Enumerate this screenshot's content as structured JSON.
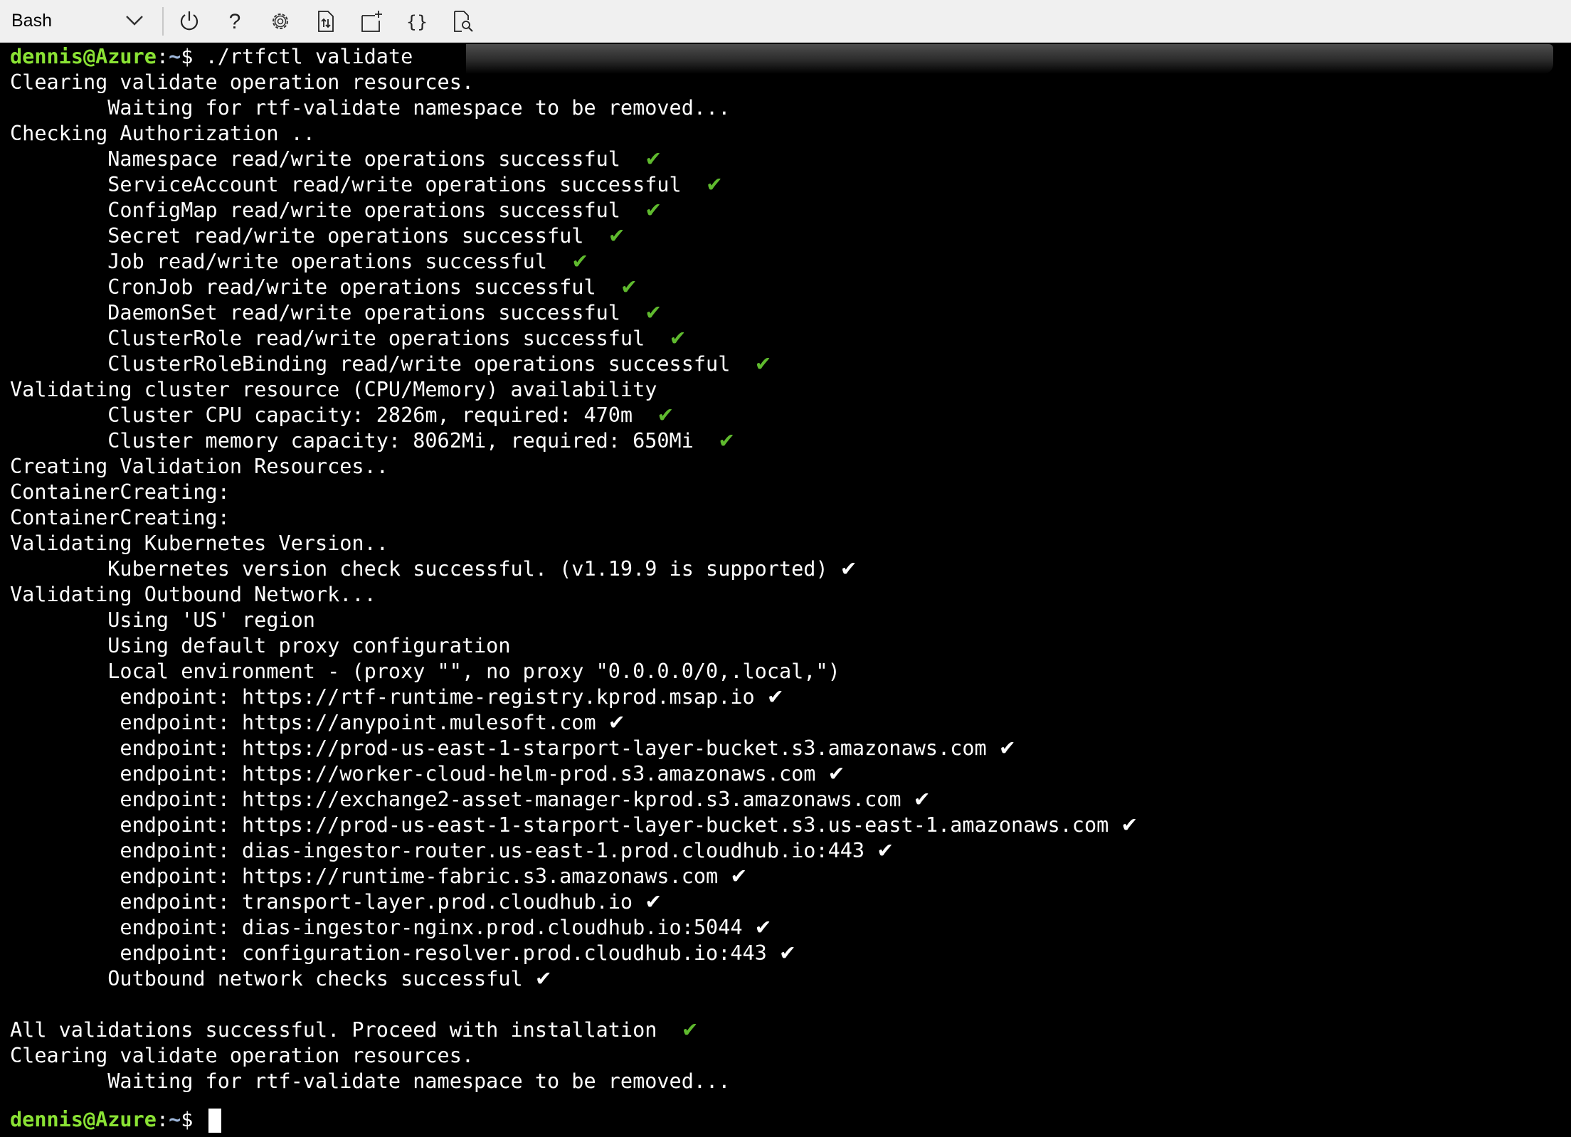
{
  "toolbar": {
    "shell": "Bash",
    "buttons": [
      {
        "name": "restart-button",
        "icon": "power-icon"
      },
      {
        "name": "help-button",
        "icon": "help-icon"
      },
      {
        "name": "settings-button",
        "icon": "gear-icon"
      },
      {
        "name": "upload-download-button",
        "icon": "file-transfer-icon"
      },
      {
        "name": "new-session-button",
        "icon": "new-session-icon"
      },
      {
        "name": "editor-button",
        "icon": "braces-icon"
      },
      {
        "name": "web-preview-button",
        "icon": "web-preview-icon"
      }
    ]
  },
  "colors": {
    "prompt_user": "#8ae234",
    "prompt_path": "#9fb8dc",
    "check_green": "#5fba2e",
    "terminal_bg": "#000000",
    "toolbar_bg": "#f0f0f0"
  },
  "prompt": {
    "user": "dennis@Azure",
    "colon": ":",
    "path": "~",
    "symbol": "$ "
  },
  "check_mark": "✔",
  "command": "./rtfctl validate",
  "lines": [
    {
      "text": "Clearing validate operation resources.",
      "check": ""
    },
    {
      "text": "        Waiting for rtf-validate namespace to be removed...",
      "check": ""
    },
    {
      "text": "Checking Authorization ..",
      "check": ""
    },
    {
      "text": "        Namespace read/write operations successful  ",
      "check": "green"
    },
    {
      "text": "        ServiceAccount read/write operations successful  ",
      "check": "green"
    },
    {
      "text": "        ConfigMap read/write operations successful  ",
      "check": "green"
    },
    {
      "text": "        Secret read/write operations successful  ",
      "check": "green"
    },
    {
      "text": "        Job read/write operations successful  ",
      "check": "green"
    },
    {
      "text": "        CronJob read/write operations successful  ",
      "check": "green"
    },
    {
      "text": "        DaemonSet read/write operations successful  ",
      "check": "green"
    },
    {
      "text": "        ClusterRole read/write operations successful  ",
      "check": "green"
    },
    {
      "text": "        ClusterRoleBinding read/write operations successful  ",
      "check": "green"
    },
    {
      "text": "Validating cluster resource (CPU/Memory) availability",
      "check": ""
    },
    {
      "text": "        Cluster CPU capacity: 2826m, required: 470m  ",
      "check": "green"
    },
    {
      "text": "        Cluster memory capacity: 8062Mi, required: 650Mi  ",
      "check": "green"
    },
    {
      "text": "Creating Validation Resources..",
      "check": ""
    },
    {
      "text": "ContainerCreating:",
      "check": ""
    },
    {
      "text": "ContainerCreating:",
      "check": ""
    },
    {
      "text": "Validating Kubernetes Version..",
      "check": ""
    },
    {
      "text": "        Kubernetes version check successful. (v1.19.9 is supported) ",
      "check": "white"
    },
    {
      "text": "Validating Outbound Network...",
      "check": ""
    },
    {
      "text": "        Using 'US' region",
      "check": ""
    },
    {
      "text": "        Using default proxy configuration",
      "check": ""
    },
    {
      "text": "        Local environment - (proxy \"\", no proxy \"0.0.0.0/0,.local,\")",
      "check": ""
    },
    {
      "text": "         endpoint: https://rtf-runtime-registry.kprod.msap.io ",
      "check": "white"
    },
    {
      "text": "         endpoint: https://anypoint.mulesoft.com ",
      "check": "white"
    },
    {
      "text": "         endpoint: https://prod-us-east-1-starport-layer-bucket.s3.amazonaws.com ",
      "check": "white"
    },
    {
      "text": "         endpoint: https://worker-cloud-helm-prod.s3.amazonaws.com ",
      "check": "white"
    },
    {
      "text": "         endpoint: https://exchange2-asset-manager-kprod.s3.amazonaws.com ",
      "check": "white"
    },
    {
      "text": "         endpoint: https://prod-us-east-1-starport-layer-bucket.s3.us-east-1.amazonaws.com ",
      "check": "white"
    },
    {
      "text": "         endpoint: dias-ingestor-router.us-east-1.prod.cloudhub.io:443 ",
      "check": "white"
    },
    {
      "text": "         endpoint: https://runtime-fabric.s3.amazonaws.com ",
      "check": "white"
    },
    {
      "text": "         endpoint: transport-layer.prod.cloudhub.io ",
      "check": "white"
    },
    {
      "text": "         endpoint: dias-ingestor-nginx.prod.cloudhub.io:5044 ",
      "check": "white"
    },
    {
      "text": "         endpoint: configuration-resolver.prod.cloudhub.io:443 ",
      "check": "white"
    },
    {
      "text": "        Outbound network checks successful ",
      "check": "white"
    },
    {
      "text": "",
      "check": ""
    },
    {
      "text": "All validations successful. Proceed with installation  ",
      "check": "green"
    },
    {
      "text": "Clearing validate operation resources.",
      "check": ""
    },
    {
      "text": "        Waiting for rtf-validate namespace to be removed...",
      "check": ""
    }
  ]
}
